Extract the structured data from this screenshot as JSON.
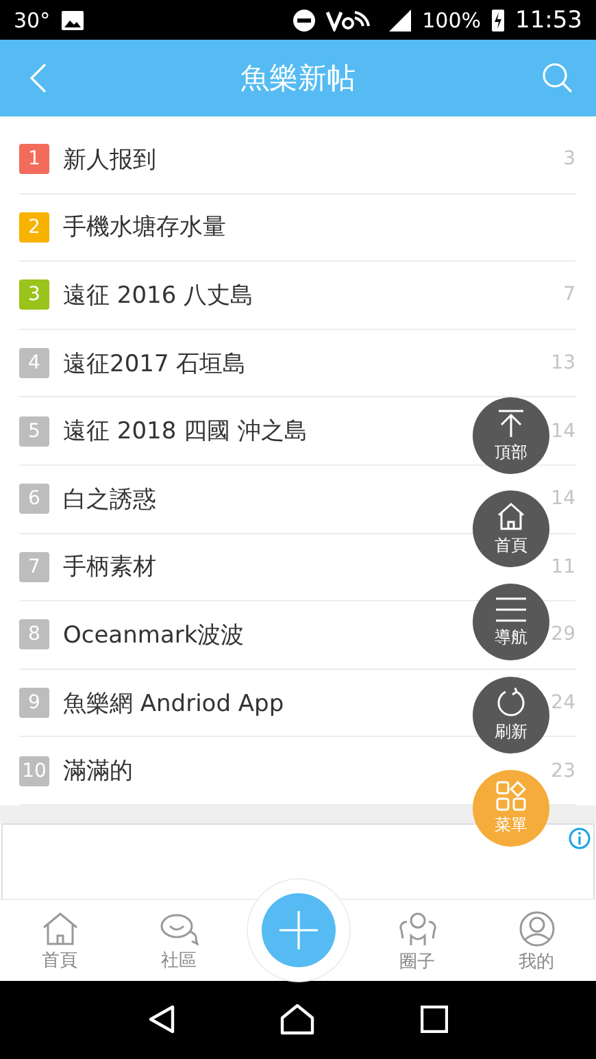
{
  "status_bar": {
    "temperature": "30°",
    "battery": "100%",
    "time": "11:53"
  },
  "header": {
    "title": "魚樂新帖"
  },
  "list": [
    {
      "number": "1",
      "title": "新人报到",
      "count": "3",
      "color": "#f26b5b"
    },
    {
      "number": "2",
      "title": "手機水塘存水量",
      "color": "#f8b200"
    },
    {
      "number": "3",
      "title": "遠征 2016 八丈島",
      "count": "7",
      "color": "#9ac31c"
    },
    {
      "number": "4",
      "title": "遠征2017 石垣島",
      "count": "13",
      "color": "#bdbdbd"
    },
    {
      "number": "5",
      "title": "遠征 2018 四國 沖之島",
      "count": "14",
      "color": "#bdbdbd"
    },
    {
      "number": "6",
      "title": "白之誘惑",
      "count": "14",
      "color": "#bdbdbd"
    },
    {
      "number": "7",
      "title": "手柄素材",
      "count": "11",
      "color": "#bdbdbd"
    },
    {
      "number": "8",
      "title": "Oceanmark波波",
      "count": "29",
      "color": "#bdbdbd"
    },
    {
      "number": "9",
      "title": "魚樂網 Andriod App",
      "count": "24",
      "color": "#bdbdbd"
    },
    {
      "number": "10",
      "title": "滿滿的",
      "count": "23",
      "color": "#bdbdbd"
    }
  ],
  "floating_buttons": [
    {
      "kind": "top",
      "label": "頂部",
      "color": "#585858"
    },
    {
      "kind": "home",
      "label": "首頁",
      "color": "#585858"
    },
    {
      "kind": "nav",
      "label": "導航",
      "color": "#585858"
    },
    {
      "kind": "refresh",
      "label": "刷新",
      "color": "#585858"
    },
    {
      "kind": "menu",
      "label": "菜單",
      "color": "#f5ac3b"
    }
  ],
  "bottom_nav": [
    {
      "kind": "home",
      "label": "首頁"
    },
    {
      "kind": "community",
      "label": "社區"
    },
    {
      "kind": "add"
    },
    {
      "kind": "circle",
      "label": "圈子"
    },
    {
      "kind": "me",
      "label": "我的"
    }
  ]
}
